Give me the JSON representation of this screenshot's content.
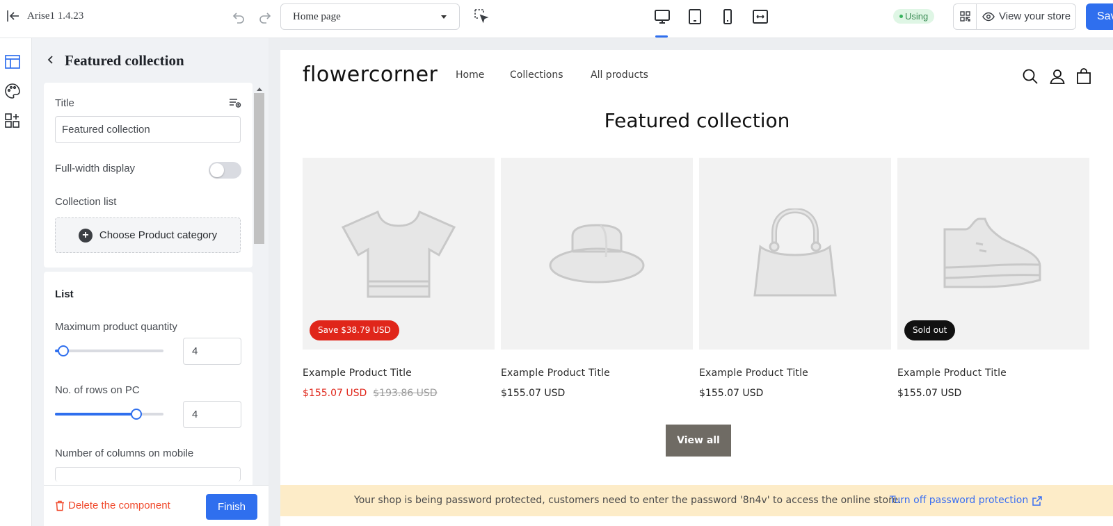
{
  "app": {
    "name": "Arise1  1.4.23"
  },
  "toolbar": {
    "page_select": "Home page",
    "status_badge": "Using",
    "view_store": "View your store",
    "save": "Save"
  },
  "panel": {
    "title": "Featured collection",
    "title_field": {
      "label": "Title",
      "value": "Featured collection"
    },
    "full_width": {
      "label": "Full-width display",
      "on": false
    },
    "collection_list": {
      "label": "Collection list",
      "button": "Choose Product category"
    },
    "list": {
      "heading": "List",
      "max_qty": {
        "label": "Maximum product quantity",
        "value": "4",
        "level": 0.08
      },
      "rows_pc": {
        "label": "No. of rows on PC",
        "value": "4",
        "level": 0.75
      },
      "cols_mobile": {
        "label": "Number of columns on mobile"
      }
    },
    "delete": "Delete the component",
    "finish": "Finish"
  },
  "store": {
    "logo": "flowercorner",
    "nav": [
      "Home",
      "Collections",
      "All products"
    ],
    "section_title": "Featured collection",
    "products": [
      {
        "title": "Example Product Title",
        "price": "$155.07 USD",
        "compare": "$193.86 USD",
        "badge": "Save $38.79 USD",
        "icon": "tshirt-icon"
      },
      {
        "title": "Example Product Title",
        "price": "$155.07 USD",
        "icon": "hat-icon"
      },
      {
        "title": "Example Product Title",
        "price": "$155.07 USD",
        "icon": "handbag-icon"
      },
      {
        "title": "Example Product Title",
        "price": "$155.07 USD",
        "badge": "Sold out",
        "icon": "shoe-icon"
      }
    ],
    "view_all": "View all",
    "password_banner": {
      "message": "Your shop is being password protected, customers need to enter the password '8n4v' to access the online store.",
      "link": "Turn off password protection"
    }
  },
  "colors": {
    "accent": "#2f6fee",
    "sale": "#e0261a",
    "danger": "#f04b2e",
    "banner": "#fdecc8"
  }
}
